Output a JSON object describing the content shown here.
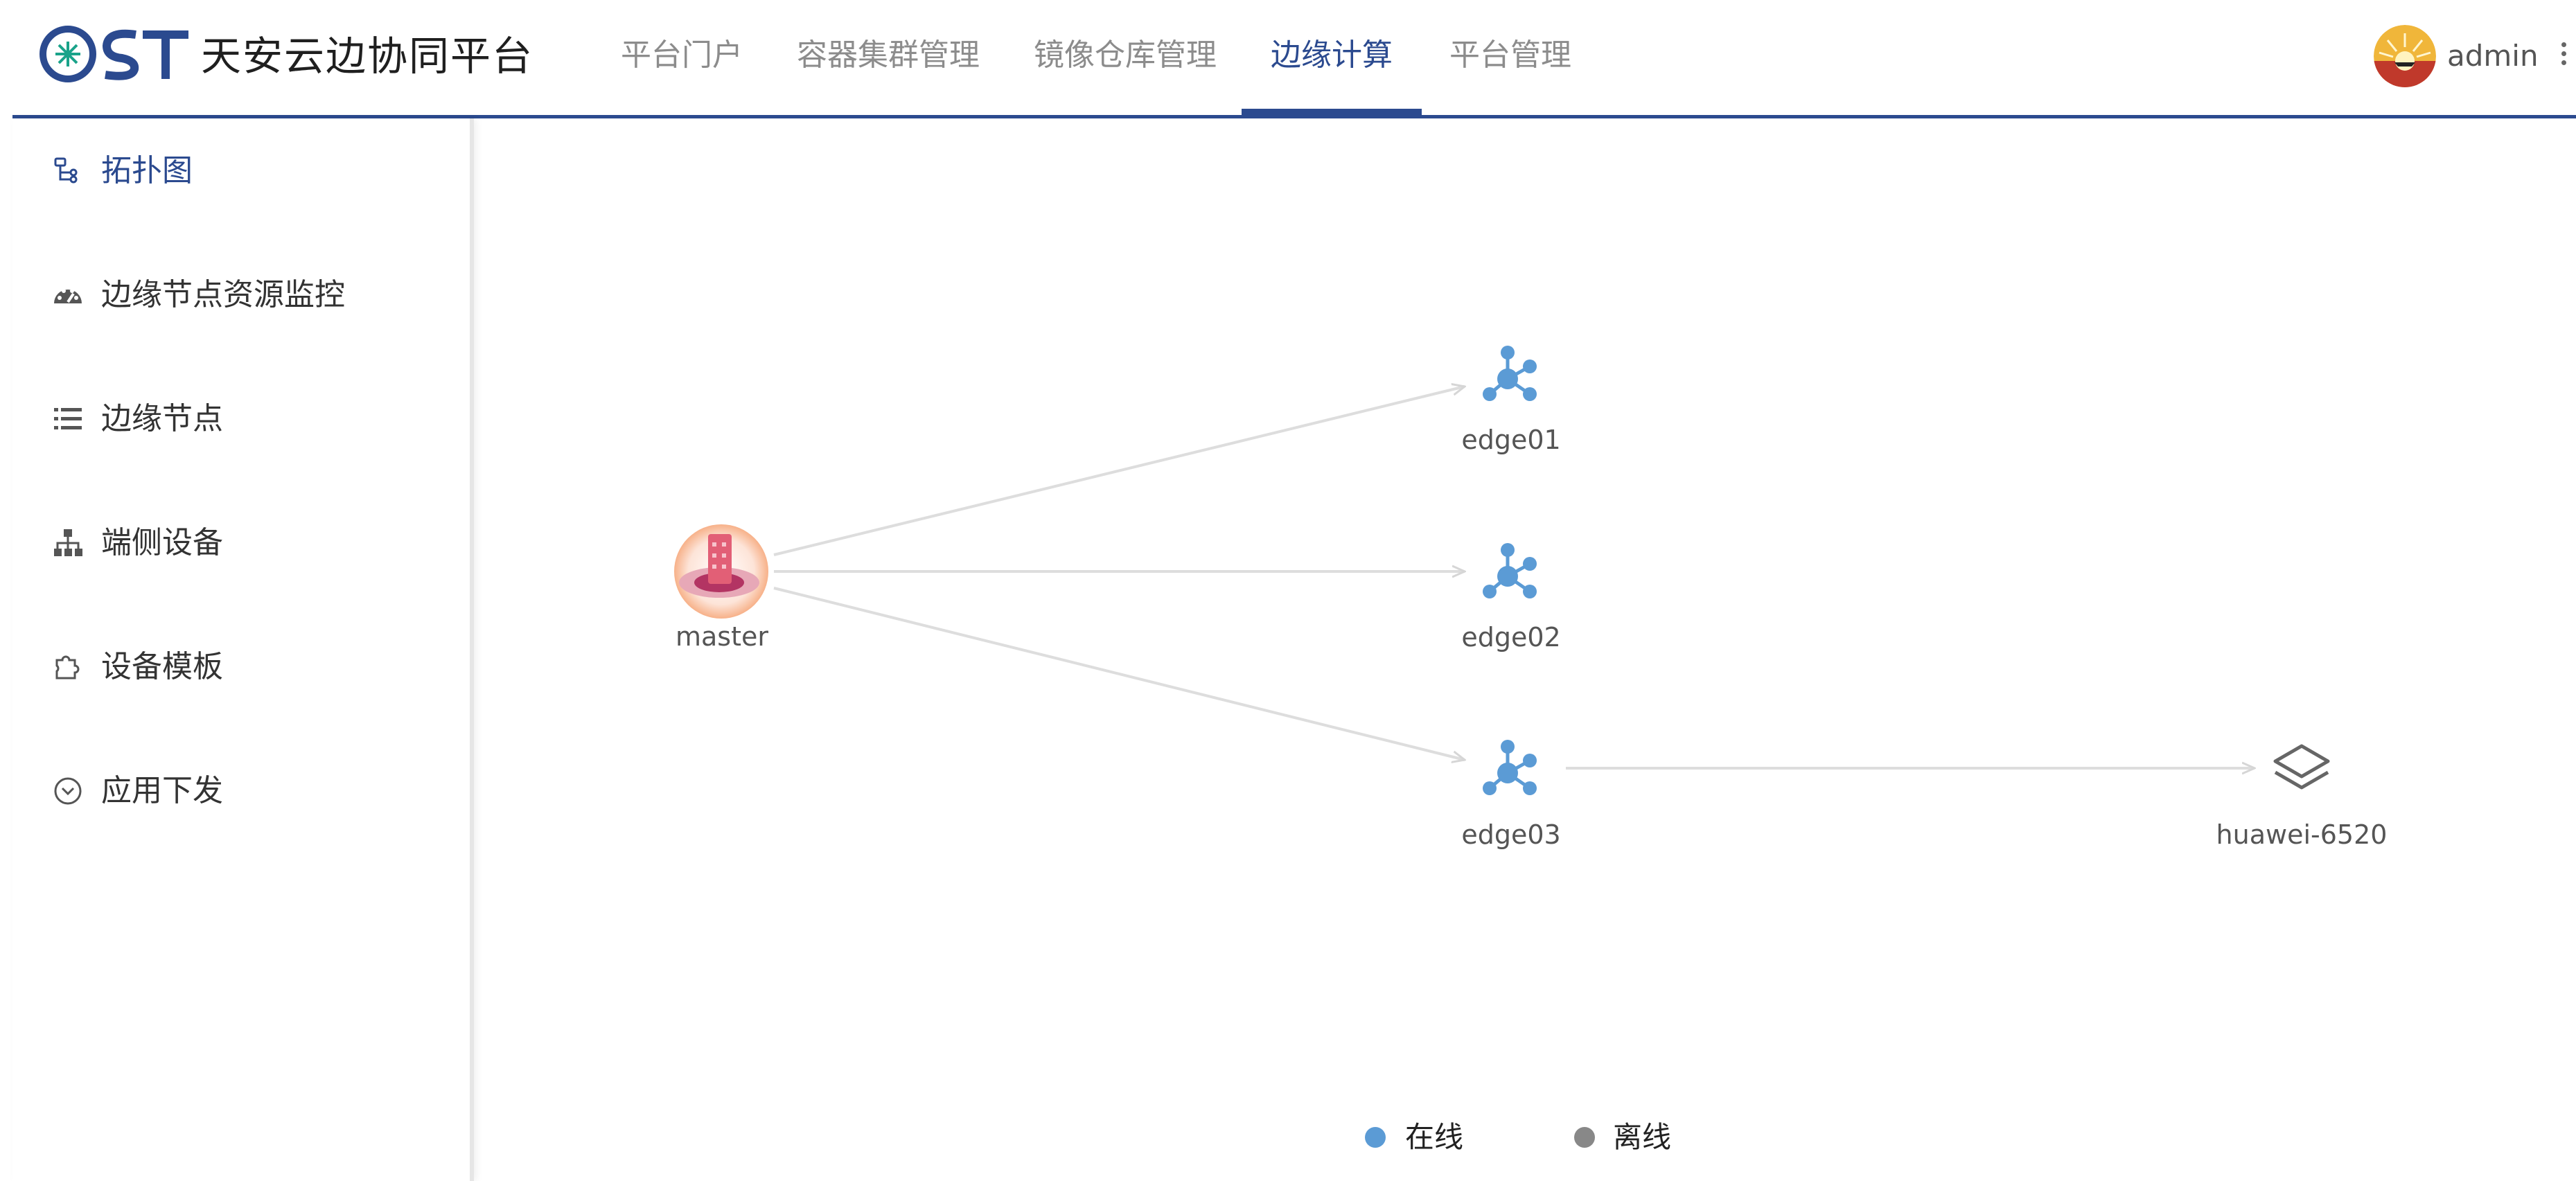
{
  "brand": {
    "logo_text": "OST",
    "title": "天安云边协同平台"
  },
  "nav": {
    "items": [
      {
        "label": "平台门户"
      },
      {
        "label": "容器集群管理"
      },
      {
        "label": "镜像仓库管理"
      },
      {
        "label": "边缘计算",
        "active": true
      },
      {
        "label": "平台管理"
      }
    ]
  },
  "user": {
    "name": "admin",
    "avatar_icon": "sunrise-avatar-icon"
  },
  "sidebar": {
    "items": [
      {
        "label": "拓扑图",
        "icon": "topology-icon",
        "active": true
      },
      {
        "label": "边缘节点资源监控",
        "icon": "dashboard-gauge-icon"
      },
      {
        "label": "边缘节点",
        "icon": "list-icon"
      },
      {
        "label": "端侧设备",
        "icon": "sitemap-icon"
      },
      {
        "label": "设备模板",
        "icon": "puzzle-icon"
      },
      {
        "label": "应用下发",
        "icon": "circle-chevron-down-icon"
      }
    ]
  },
  "topology": {
    "nodes": [
      {
        "id": "master",
        "label": "master",
        "type": "master"
      },
      {
        "id": "edge01",
        "label": "edge01",
        "type": "edge",
        "status": "online"
      },
      {
        "id": "edge02",
        "label": "edge02",
        "type": "edge",
        "status": "online"
      },
      {
        "id": "edge03",
        "label": "edge03",
        "type": "edge",
        "status": "online"
      },
      {
        "id": "huawei-6520",
        "label": "huawei-6520",
        "type": "device"
      }
    ],
    "edges": [
      {
        "from": "master",
        "to": "edge01"
      },
      {
        "from": "master",
        "to": "edge02"
      },
      {
        "from": "master",
        "to": "edge03"
      },
      {
        "from": "edge03",
        "to": "huawei-6520"
      }
    ]
  },
  "legend": [
    {
      "label": "在线",
      "color": "#5b9bd5"
    },
    {
      "label": "离线",
      "color": "#888888"
    }
  ],
  "colors": {
    "accent": "#2b4a8f",
    "online": "#5b9bd5",
    "offline": "#888888",
    "edge_line": "#dddddd"
  }
}
